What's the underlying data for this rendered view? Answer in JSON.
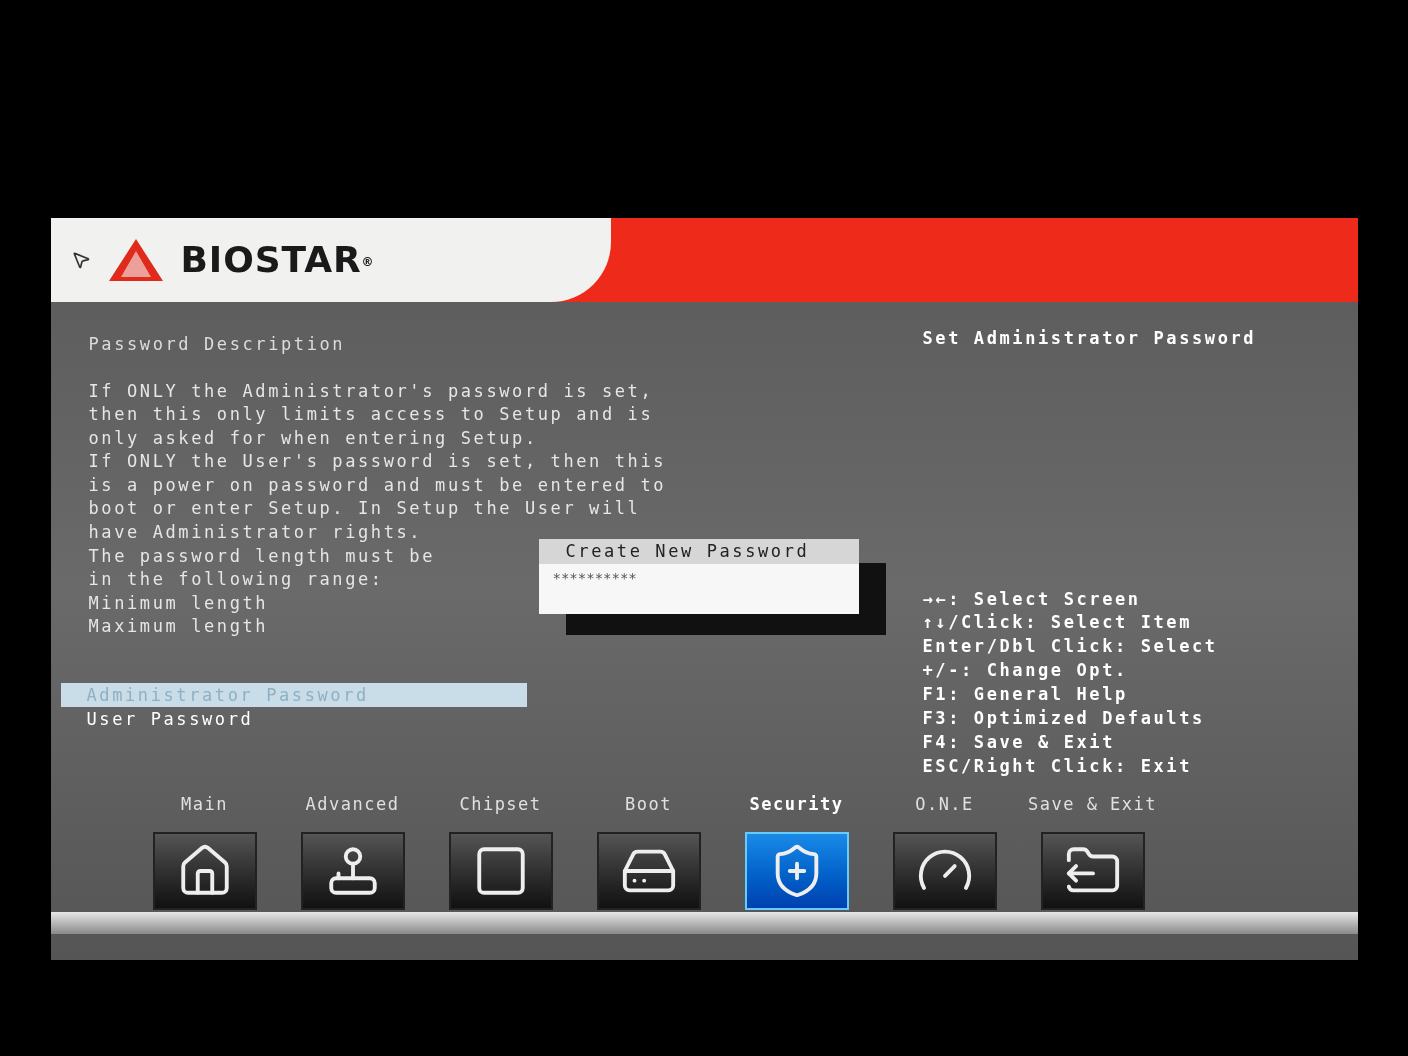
{
  "header": {
    "logo": "BIOSTAR",
    "logo_mark": "®"
  },
  "description": {
    "title": "Password Description",
    "lines": [
      "If ONLY the Administrator's password is set,",
      "then this only limits access to Setup and is",
      "only asked for when entering Setup.",
      "If ONLY the User's password is set, then this",
      "is a power on password and must be entered to",
      "boot or enter Setup. In Setup the User will",
      "have Administrator rights.",
      "The password length must be",
      "in the following range:",
      "Minimum length",
      "Maximum length"
    ]
  },
  "items": [
    {
      "label": "Administrator Password",
      "selected": true
    },
    {
      "label": "User Password",
      "selected": false
    }
  ],
  "dialog": {
    "title": "Create New Password",
    "value": "**********"
  },
  "help_title": "Set Administrator Password",
  "help_keys": [
    "→←: Select Screen",
    "↑↓/Click: Select Item",
    "Enter/Dbl Click: Select",
    "+/-: Change Opt.",
    "F1: General Help",
    "F3: Optimized Defaults",
    "F4: Save & Exit",
    "ESC/Right Click: Exit"
  ],
  "tabs": [
    {
      "label": "Main",
      "selected": false
    },
    {
      "label": "Advanced",
      "selected": false
    },
    {
      "label": "Chipset",
      "selected": false
    },
    {
      "label": "Boot",
      "selected": false
    },
    {
      "label": "Security",
      "selected": true
    },
    {
      "label": "O.N.E",
      "selected": false
    },
    {
      "label": "Save & Exit",
      "selected": false
    }
  ]
}
